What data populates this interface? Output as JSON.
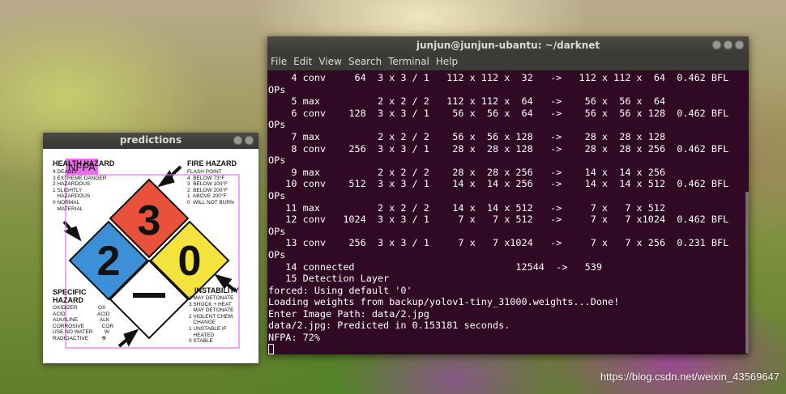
{
  "predictions_window": {
    "title": "predictions",
    "detection_label": "NFPA",
    "placard": {
      "health_title": "HEALTH HAZARD",
      "health_lines": "4 DEADLY\n3 EXTREME DANGER\n2 HAZARDOUS\n1 SLIGHTLY\n   HAZARDOUS\n0 NORMAL\n   MATERIAL",
      "fire_title": "FIRE HAZARD",
      "fire_lines": "FLASH POINT\n4  BELOW 73°F\n3  BELOW 100°F\n2  BELOW 200°F\n1  ABOVE 200°F\n0  WILL NOT BURN",
      "specific_title": "SPECIFIC\nHAZARD",
      "specific_lines": "OXIDIZER              OX\nACID                      ACID\nALKALINE               ALK\nCORROSIVE            COR\nUSE NO WATER        W\nRADIOACTIVE         ☢",
      "instability_title": "INSTABILITY",
      "instability_lines": "4 MAY DETONATE\n3 SHOCK + HEAT\n   MAY DETONATE\n2 VIOLENT CHEM.\n   CHANGE\n1 UNSTABLE IF\n   HEATED\n0 STABLE",
      "fire_value": "3",
      "health_value": "2",
      "instability_value": "0",
      "colors": {
        "fire": "#e8513a",
        "health": "#3d8fd8",
        "instability": "#f3e33c",
        "special": "#ffffff",
        "box": "#e86fe8"
      }
    }
  },
  "terminal": {
    "title": "junjun@junjun-ubantu: ~/darknet",
    "menu": [
      "File",
      "Edit",
      "View",
      "Search",
      "Terminal",
      "Help"
    ],
    "lines": [
      "    4 conv     64  3 x 3 / 1   112 x 112 x  32   ->   112 x 112 x  64  0.462 BFL",
      "OPs",
      "    5 max          2 x 2 / 2   112 x 112 x  64   ->    56 x  56 x  64",
      "    6 conv    128  3 x 3 / 1    56 x  56 x  64   ->    56 x  56 x 128  0.462 BFL",
      "OPs",
      "    7 max          2 x 2 / 2    56 x  56 x 128   ->    28 x  28 x 128",
      "    8 conv    256  3 x 3 / 1    28 x  28 x 128   ->    28 x  28 x 256  0.462 BFL",
      "OPs",
      "    9 max          2 x 2 / 2    28 x  28 x 256   ->    14 x  14 x 256",
      "   10 conv    512  3 x 3 / 1    14 x  14 x 256   ->    14 x  14 x 512  0.462 BFL",
      "OPs",
      "   11 max          2 x 2 / 2    14 x  14 x 512   ->     7 x   7 x 512",
      "   12 conv   1024  3 x 3 / 1     7 x   7 x 512   ->     7 x   7 x1024  0.462 BFL",
      "OPs",
      "   13 conv    256  3 x 3 / 1     7 x   7 x1024   ->     7 x   7 x 256  0.231 BFL",
      "OPs",
      "   14 connected                            12544  ->   539",
      "   15 Detection Layer",
      "forced: Using default '0'",
      "Loading weights from backup/yolov1-tiny_31000.weights...Done!",
      "Enter Image Path: data/2.jpg",
      "data/2.jpg: Predicted in 0.153181 seconds.",
      "NFPA: 72%"
    ],
    "colors": {
      "background": "#300a24",
      "text": "#ffffff"
    }
  },
  "watermark": "https://blog.csdn.net/weixin_43569647"
}
